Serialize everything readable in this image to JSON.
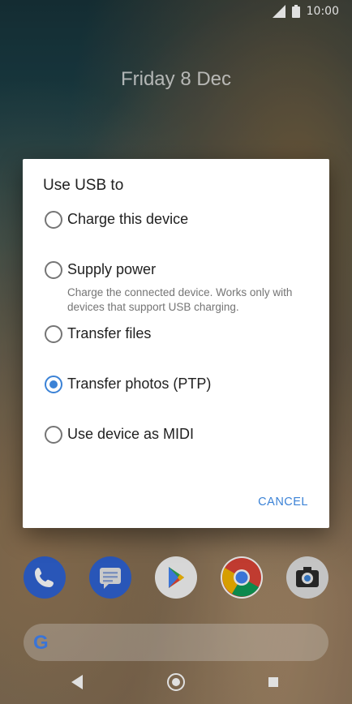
{
  "status_bar": {
    "time": "10:00"
  },
  "lockscreen": {
    "date": "Friday 8 Dec"
  },
  "dialog": {
    "title": "Use USB to",
    "options": [
      {
        "label": "Charge this device",
        "checked": false
      },
      {
        "label": "Supply power",
        "subtitle": "Charge the connected device. Works only with devices that support USB charging.",
        "checked": false
      },
      {
        "label": "Transfer files",
        "checked": false
      },
      {
        "label": "Transfer photos (PTP)",
        "checked": true
      },
      {
        "label": "Use device as MIDI",
        "checked": false
      }
    ],
    "cancel_label": "CANCEL"
  },
  "dock": {
    "apps": [
      {
        "name": "phone-icon"
      },
      {
        "name": "messages-icon"
      },
      {
        "name": "play-store-icon"
      },
      {
        "name": "chrome-icon"
      },
      {
        "name": "camera-icon"
      }
    ]
  },
  "search": {
    "logo_letter": "G"
  },
  "colors": {
    "accent": "#3b82d6",
    "dialog_bg": "#ffffff"
  }
}
